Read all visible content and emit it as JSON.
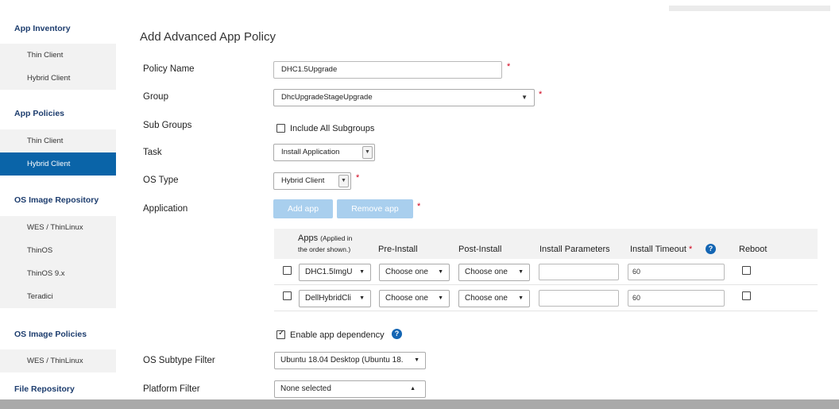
{
  "sidebar": {
    "sections": [
      {
        "heading": "App Inventory",
        "items": [
          "Thin Client",
          "Hybrid Client"
        ]
      },
      {
        "heading": "App Policies",
        "items": [
          "Thin Client",
          "Hybrid Client"
        ],
        "active_index": 1
      },
      {
        "heading": "OS Image Repository",
        "items": [
          "WES / ThinLinux",
          "ThinOS",
          "ThinOS 9.x",
          "Teradici"
        ]
      },
      {
        "heading": "OS Image Policies",
        "items": [
          "WES / ThinLinux"
        ]
      },
      {
        "heading": "File Repository",
        "items": []
      }
    ]
  },
  "form": {
    "title": "Add Advanced App Policy",
    "policy_name": {
      "label": "Policy Name",
      "value": "DHC1.5Upgrade",
      "required": "*"
    },
    "group": {
      "label": "Group",
      "value": "DhcUpgradeStageUpgrade",
      "required": "*"
    },
    "sub_groups": {
      "label": "Sub Groups",
      "checkbox_label": "Include All Subgroups"
    },
    "task": {
      "label": "Task",
      "value": "Install Application"
    },
    "os_type": {
      "label": "OS Type",
      "value": "Hybrid Client",
      "required": "*"
    },
    "application": {
      "label": "Application",
      "add_label": "Add app",
      "remove_label": "Remove app",
      "required": "*"
    },
    "enable_dependency": {
      "label": "Enable app dependency"
    },
    "os_subtype": {
      "label": "OS Subtype Filter",
      "value": "Ubuntu 18.04 Desktop (Ubuntu 18."
    },
    "platform": {
      "label": "Platform Filter",
      "value": "None selected"
    }
  },
  "apps_table": {
    "headers": {
      "apps": "Apps",
      "apps_note_1": "(Applied in",
      "apps_note_2": "the order shown.)",
      "pre_install": "Pre-Install",
      "post_install": "Post-Install",
      "install_parameters": "Install Parameters",
      "install_timeout": "Install Timeout",
      "timeout_required": "*",
      "reboot": "Reboot"
    },
    "rows": [
      {
        "app": "DHC1.5ImgU",
        "pre": "Choose one",
        "post": "Choose one",
        "params": "",
        "timeout": "60"
      },
      {
        "app": "DellHybridCli",
        "pre": "Choose one",
        "post": "Choose one",
        "params": "",
        "timeout": "60"
      }
    ]
  },
  "icons": {
    "help": "?",
    "caret": "▼",
    "caret_up": "▲"
  },
  "colors": {
    "active_nav": "#0a64a8",
    "heading": "#1d3d6e",
    "button_disabled": "#a9cfee",
    "required": "#d0021b",
    "help": "#1365b3"
  }
}
